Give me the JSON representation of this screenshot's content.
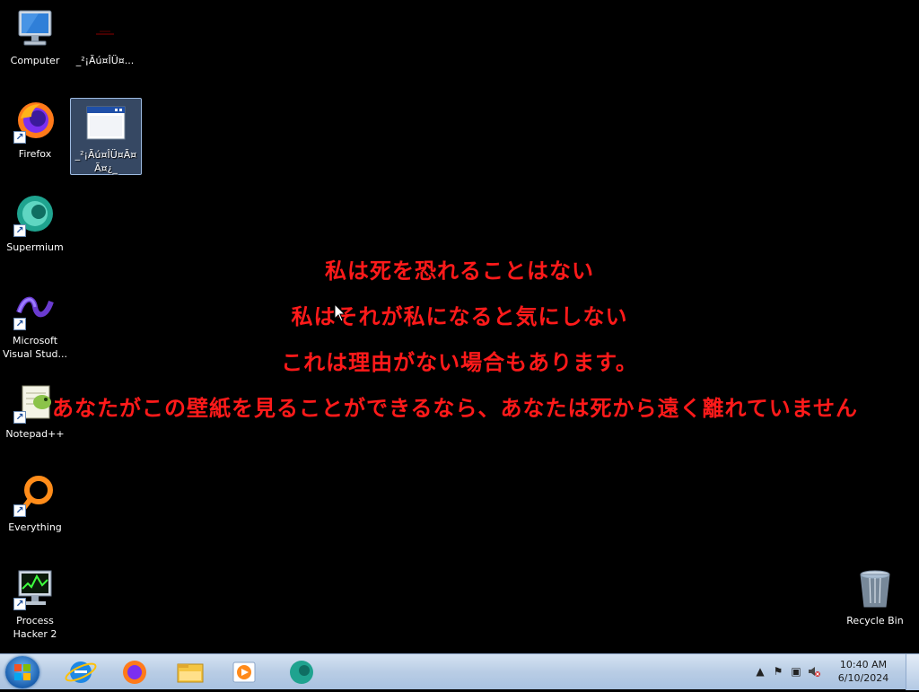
{
  "desktop": {
    "icons": [
      {
        "label": "Computer"
      },
      {
        "label": "_²¡Ãú¤ÎÜ¤..."
      },
      {
        "label": "Firefox"
      },
      {
        "label": "_²¡Ãú¤ÎÜ¤Ã¤\nÃ¤¿_"
      },
      {
        "label": "Supermium"
      },
      {
        "label": "Microsoft\nVisual Stud..."
      },
      {
        "label": "Notepad++"
      },
      {
        "label": "Everything"
      },
      {
        "label": "Process\nHacker 2"
      },
      {
        "label": "Recycle Bin"
      }
    ],
    "wallpaper_lines": [
      "私は死を恐れることはない",
      "私はそれが私になると気にしない",
      "これは理由がない場合もあります。",
      "あなたがこの壁紙を見ることができるなら、あなたは死から遠く離れていません"
    ],
    "wallpaper_color": "#ff1a1a"
  },
  "taskbar": {
    "pinned": [
      "start-orb-icon",
      "internet-explorer-icon",
      "firefox-icon",
      "file-explorer-icon",
      "media-player-icon",
      "supermium-icon"
    ],
    "clock_time": "10:40 AM",
    "clock_date": "6/10/2024"
  }
}
